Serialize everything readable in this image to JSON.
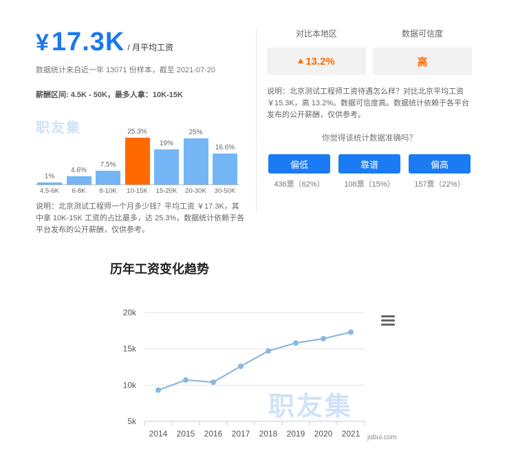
{
  "salary": {
    "currency": "¥",
    "amount": "17.3K",
    "unit": "/ 月平均工资",
    "meta": "数据统计来自近一年 13071 份样本，截至 2021-07-20",
    "range": "薪酬区间: 4.5K - 50K，最多人拿：10K-15K",
    "watermark": "职友集",
    "note": "说明：北京测试工程师一个月多少钱？平均工资 ￥17.3K，其中拿 10K-15K 工资的占比最多，达 25.3%，数据统计依赖于各平台发布的公开薪酬，仅供参考。"
  },
  "compare": {
    "local_label": "对比本地区",
    "trust_label": "数据可信度",
    "local_value": "13.2%",
    "trust_value": "高",
    "note": "说明：北京测试工程师工资待遇怎么样？对比北京平均工资￥15.3K，高 13.2%。数据可信度高。数据统计依赖于各平台发布的公开薪酬，仅供参考。",
    "question": "你觉得该统计数据准确吗？",
    "votes": [
      {
        "label": "偏低",
        "count": "436票（62%）"
      },
      {
        "label": "靠谱",
        "count": "108票（15%）"
      },
      {
        "label": "偏高",
        "count": "157票（22%）"
      }
    ]
  },
  "trend": {
    "title": "历年工资变化趋势",
    "watermark": "职友集",
    "source": "jobui.com"
  },
  "chart_data": [
    {
      "type": "bar",
      "categories": [
        "4.5-6K",
        "6-8K",
        "8-10K",
        "10-15K",
        "15-20K",
        "20-30K",
        "30-50K"
      ],
      "values": [
        1,
        4.6,
        7.5,
        25.3,
        19,
        25,
        16.6
      ],
      "data_labels": [
        "1%",
        "4.6%",
        "7.5%",
        "25.3%",
        "19%",
        "25%",
        "16.6%"
      ],
      "highlight_index": 3,
      "colors": {
        "bar": "#74b6f5",
        "highlight": "#ff6a00"
      }
    },
    {
      "type": "line",
      "x": [
        2014,
        2015,
        2016,
        2017,
        2018,
        2019,
        2020,
        2021
      ],
      "values": [
        9.3,
        10.7,
        10.4,
        12.6,
        14.7,
        15.8,
        16.4,
        17.3
      ],
      "yticks": [
        "5k",
        "10k",
        "15k",
        "20k"
      ],
      "ylim": [
        5,
        20
      ],
      "grid": true,
      "colors": {
        "line": "#8bb8e0",
        "point": "#8bb8e0"
      }
    }
  ]
}
